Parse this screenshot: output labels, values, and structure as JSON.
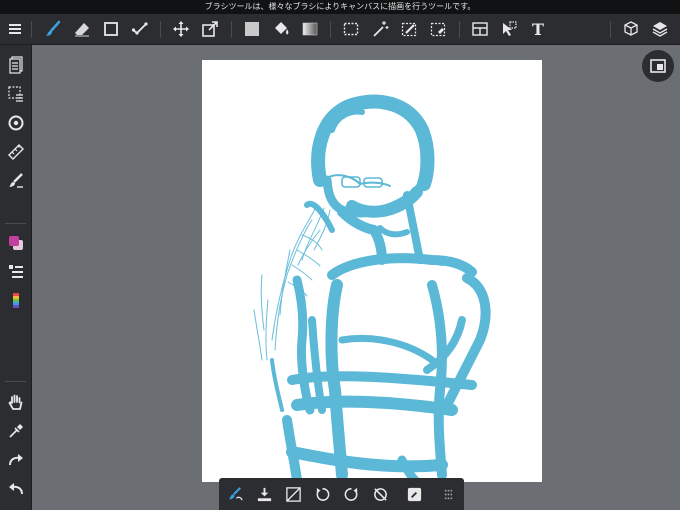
{
  "tip": {
    "text": "ブラシツールは、様々なブラシによりキャンバスに描画を行うツールです。"
  },
  "toolbar": {
    "items": [
      {
        "icon": "menu-icon"
      },
      {
        "icon": "brush-icon",
        "active": true
      },
      {
        "icon": "eraser-icon"
      },
      {
        "icon": "rectangle-icon"
      },
      {
        "icon": "dot-tool-icon"
      },
      {
        "icon": "move-icon"
      },
      {
        "icon": "transform-icon"
      },
      {
        "icon": "fill-color-icon"
      },
      {
        "icon": "bucket-icon"
      },
      {
        "icon": "gradient-icon"
      },
      {
        "icon": "select-icon"
      },
      {
        "icon": "magic-wand-icon"
      },
      {
        "icon": "select-pen-icon"
      },
      {
        "icon": "select-eraser-icon"
      },
      {
        "icon": "frame-divider-icon"
      },
      {
        "icon": "operation-icon"
      },
      {
        "icon": "text-icon",
        "label": "T"
      },
      {
        "icon": "3d-icon"
      },
      {
        "icon": "layers-icon"
      }
    ]
  },
  "left_toolbar": {
    "items": [
      {
        "icon": "brush-panel-icon"
      },
      {
        "icon": "selection-panel-icon"
      },
      {
        "icon": "snap-icon"
      },
      {
        "icon": "ruler-icon"
      },
      {
        "icon": "brush-settings-icon"
      },
      {
        "icon": "color-swatch-icon"
      },
      {
        "icon": "brush-list-icon"
      },
      {
        "icon": "palette-icon"
      },
      {
        "icon": "hand-icon"
      },
      {
        "icon": "eyedropper-icon"
      },
      {
        "icon": "redo-icon"
      },
      {
        "icon": "undo-icon"
      }
    ]
  },
  "colors": {
    "brand_blue": "#3aa0e0",
    "stroke": "#5bb8d6",
    "swatch_fg": "#c23f9e",
    "swatch_bg": "#e6c9de"
  },
  "navigator": {
    "icon": "navigator-icon"
  },
  "bottom_bar": {
    "items": [
      {
        "icon": "brush-correction-icon"
      },
      {
        "icon": "save-download-icon"
      },
      {
        "icon": "clear-layer-icon"
      },
      {
        "icon": "rotate-left-icon"
      },
      {
        "icon": "rotate-right-icon"
      },
      {
        "icon": "reset-rotation-icon"
      },
      {
        "icon": "edit-icon"
      },
      {
        "icon": "grid-handle-icon"
      }
    ]
  }
}
